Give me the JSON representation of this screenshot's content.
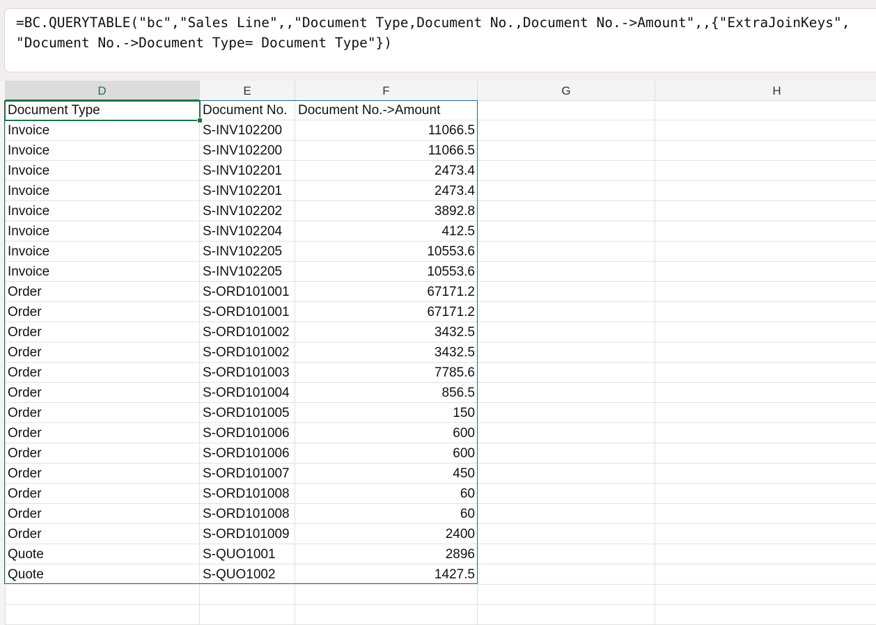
{
  "formula": {
    "line1": "=BC.QUERYTABLE(\"bc\",\"Sales Line\",,\"Document Type,Document No.,Document No.->Amount\",,{\"ExtraJoinKeys\",",
    "line2": "\"Document No.->Document Type= Document Type\"})"
  },
  "columns": [
    "D",
    "E",
    "F",
    "G",
    "H"
  ],
  "active_column": "D",
  "table": {
    "headers": [
      "Document Type",
      "Document No.",
      "Document No.->Amount"
    ],
    "rows": [
      [
        "Invoice",
        "S-INV102200",
        "11066.5"
      ],
      [
        "Invoice",
        "S-INV102200",
        "11066.5"
      ],
      [
        "Invoice",
        "S-INV102201",
        "2473.4"
      ],
      [
        "Invoice",
        "S-INV102201",
        "2473.4"
      ],
      [
        "Invoice",
        "S-INV102202",
        "3892.8"
      ],
      [
        "Invoice",
        "S-INV102204",
        "412.5"
      ],
      [
        "Invoice",
        "S-INV102205",
        "10553.6"
      ],
      [
        "Invoice",
        "S-INV102205",
        "10553.6"
      ],
      [
        "Order",
        "S-ORD101001",
        "67171.2"
      ],
      [
        "Order",
        "S-ORD101001",
        "67171.2"
      ],
      [
        "Order",
        "S-ORD101002",
        "3432.5"
      ],
      [
        "Order",
        "S-ORD101002",
        "3432.5"
      ],
      [
        "Order",
        "S-ORD101003",
        "7785.6"
      ],
      [
        "Order",
        "S-ORD101004",
        "856.5"
      ],
      [
        "Order",
        "S-ORD101005",
        "150"
      ],
      [
        "Order",
        "S-ORD101006",
        "600"
      ],
      [
        "Order",
        "S-ORD101006",
        "600"
      ],
      [
        "Order",
        "S-ORD101007",
        "450"
      ],
      [
        "Order",
        "S-ORD101008",
        "60"
      ],
      [
        "Order",
        "S-ORD101008",
        "60"
      ],
      [
        "Order",
        "S-ORD101009",
        "2400"
      ],
      [
        "Quote",
        "S-QUO1001",
        "2896"
      ],
      [
        "Quote",
        "S-QUO1002",
        "1427.5"
      ]
    ]
  },
  "colors": {
    "active_accent": "#1e7145",
    "table_border": "#1e6a7d",
    "header_bg": "#f4f4f4"
  }
}
